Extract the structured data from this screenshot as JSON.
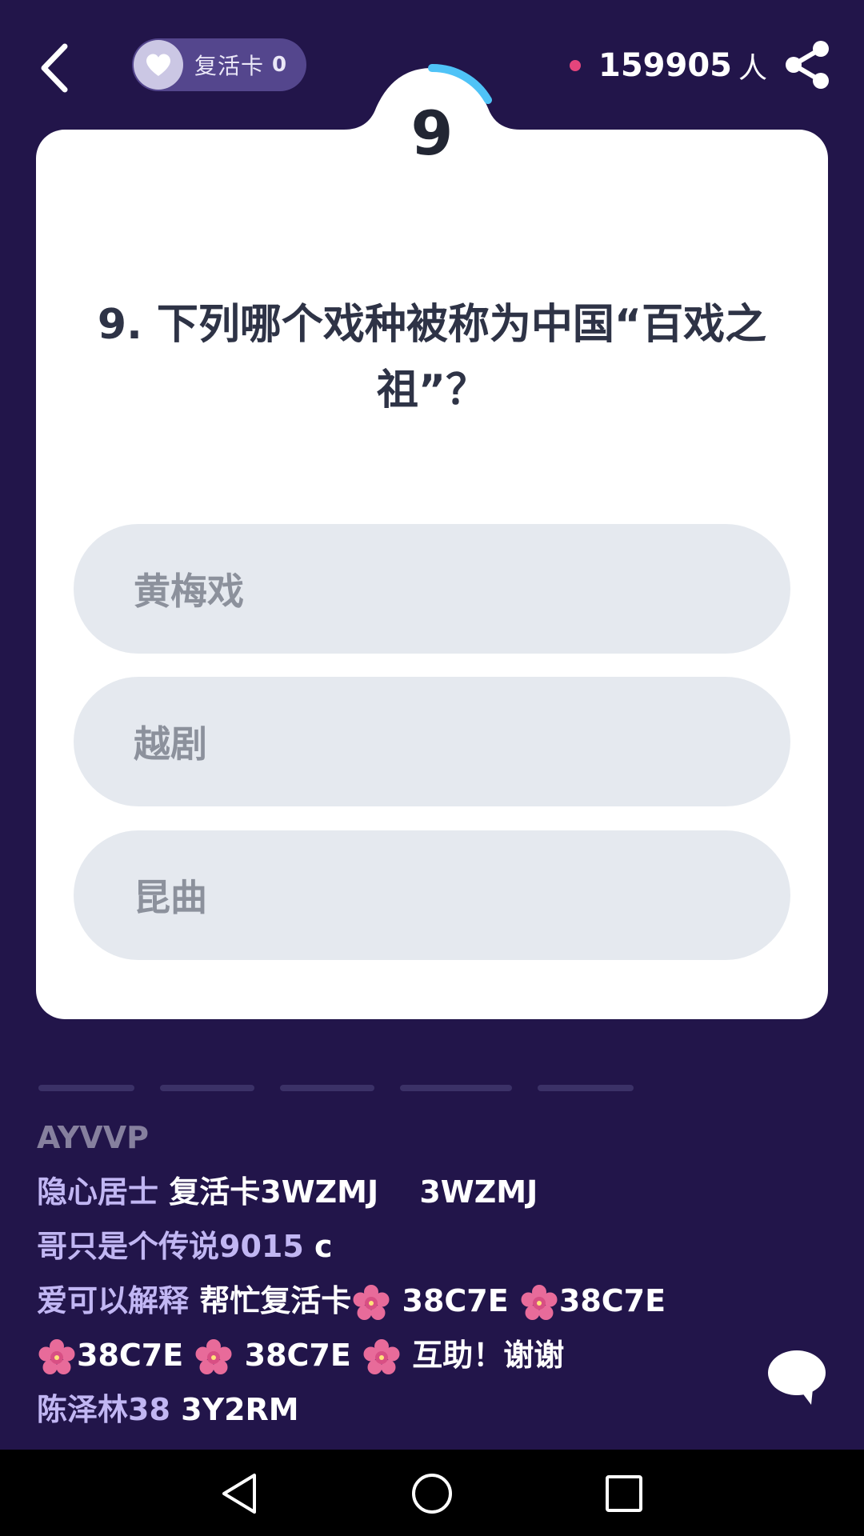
{
  "topbar": {
    "revive_label": "复活卡",
    "revive_count": "0",
    "online_count": "159905",
    "online_unit": "人"
  },
  "question": {
    "number": "9",
    "text": "9. 下列哪个戏种被称为中国“百戏之祖”？",
    "options": [
      "黄梅戏",
      "越剧",
      "昆曲"
    ]
  },
  "comments": [
    {
      "user": "AYVVP",
      "msg": ""
    },
    {
      "user": "隐心居士",
      "msg": "复活卡3WZMJ　  3WZMJ"
    },
    {
      "user": "哥只是个传说9015",
      "msg": "c"
    },
    {
      "user": "爱可以解释",
      "msg_a": "帮忙复活卡",
      "msg_b": "38C7E",
      "msg_c": "38C7E"
    },
    {
      "msg_a": "38C7E",
      "msg_b": "38C7E",
      "msg_c": "互助！谢谢"
    },
    {
      "user": "陈泽林38",
      "msg": "3Y2RM"
    }
  ],
  "colors": {
    "background": "#22154a",
    "card": "#ffffff",
    "option_bg": "#e5e9ef",
    "timer_ring": "#4fc3f7",
    "username": "#c1b6f3",
    "online_dot": "#e4457c"
  },
  "icons": {
    "back": "chevron-left-icon",
    "revive": "heart-icon",
    "share": "share-icon",
    "chat": "chat-bubble-icon",
    "flower": "cherry-blossom-icon",
    "nav": [
      "nav-back-icon",
      "nav-home-icon",
      "nav-recents-icon"
    ]
  }
}
